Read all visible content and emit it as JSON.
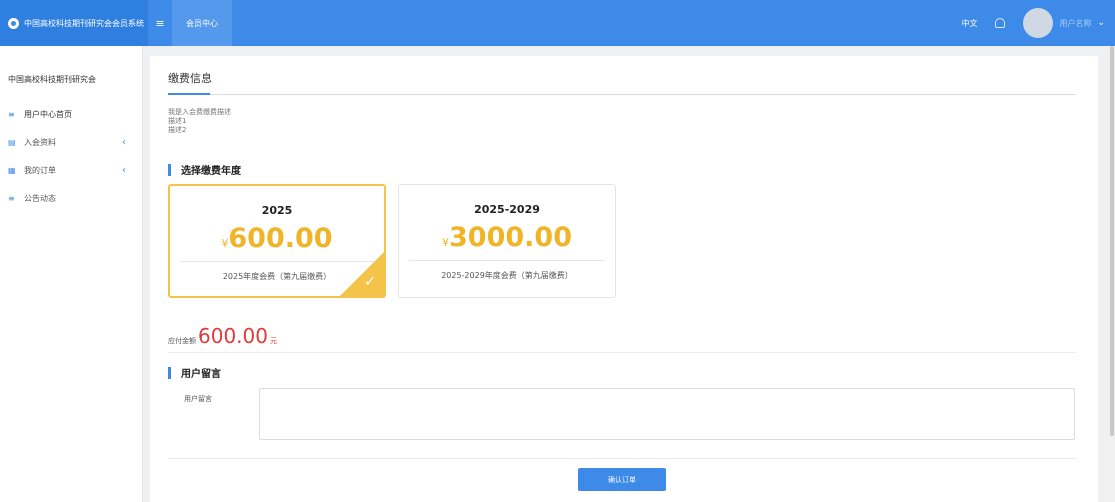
{
  "header": {
    "brand": "中国高校科技期刊研究会会员系统",
    "menu_icon": "hamburger-icon",
    "active_tab": "会员中心",
    "language": "中文",
    "bell_icon": "bell-icon",
    "user_name": "用户名称",
    "chevron_icon": "chevron-down-icon"
  },
  "sidebar": {
    "org_name": "中国高校科技期刊研究会",
    "items": [
      {
        "label": "用户中心首页",
        "icon": "list-icon",
        "has_arrow": false
      },
      {
        "label": "入会资料",
        "icon": "document-icon",
        "has_arrow": true
      },
      {
        "label": "我的订单",
        "icon": "order-icon",
        "has_arrow": true
      },
      {
        "label": "公告动态",
        "icon": "list-icon",
        "has_arrow": false
      }
    ],
    "arrow": "‹"
  },
  "main": {
    "title": "缴费信息",
    "description_lines": [
      "我是入会费缴费描述",
      "描述1",
      "描述2"
    ],
    "section_year": "选择缴费年度",
    "plans": [
      {
        "year": "2025",
        "currency": "¥",
        "price": "600.00",
        "name": "2025年度会费（第九届缴费）",
        "selected": true
      },
      {
        "year": "2025-2029",
        "currency": "¥",
        "price": "3000.00",
        "name": "2025-2029年度会费（第九届缴费）",
        "selected": false
      }
    ],
    "amount_label": "应付金额",
    "amount_value": "600.00",
    "amount_unit": "元",
    "section_message": "用户留言",
    "message_label": "用户留言",
    "message_value": "",
    "confirm_label": "确认订单"
  },
  "colors": {
    "primary": "#3d8ae8",
    "gold": "#f0b429",
    "price_red": "#e03a3a"
  }
}
